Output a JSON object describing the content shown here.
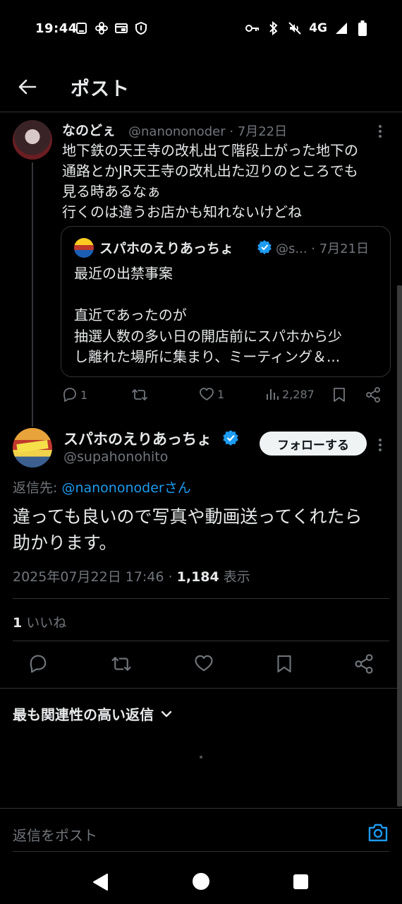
{
  "status_bar": {
    "time": "19:44",
    "network": "4G",
    "left_icons": [
      "screenshot-icon",
      "fan-icon",
      "cast-icon",
      "shield-icon"
    ],
    "right_icons": [
      "key-icon",
      "bluetooth-icon",
      "mute-icon",
      "signal-icon",
      "battery-icon"
    ]
  },
  "header": {
    "back_icon": "arrow-left-icon",
    "title": "ポスト"
  },
  "parent_tweet": {
    "name": "なのどぇ",
    "handle_date": "@nanononoder · 7月22日",
    "text": "地下鉄の天王寺の改札出て階段上がった地下の\n通路とかJR天王寺の改札出た辺りのところでも\n見る時あるなぁ\n行くのは違うお店かも知れないけどね",
    "quote": {
      "name": "スパホのえりあっちょ",
      "handle_date": "@s... · 7月21日",
      "text": "最近の出禁事案\n\n直近であったのが\n抽選人数の多い日の開店前にスパホから少\nし離れた場所に集まり、ミーティング＆..."
    },
    "actions": {
      "replies": "1",
      "retweets": "",
      "likes": "1",
      "views": "2,287"
    }
  },
  "main_tweet": {
    "name": "スパホのえりあっちょ",
    "handle": "@supahonohito",
    "follow_label": "フォローする",
    "reply_prefix": "返信先: ",
    "reply_mention": "@nanononoderさん",
    "text": "違っても良いので写真や動画送ってくれたら\n助かります。",
    "datetime": "2025年07月22日 17:46 · ",
    "views_count": "1,184",
    "views_label": " 表示",
    "likes_count": "1",
    "likes_label": " いいね"
  },
  "replies_section": {
    "sort_label": "最も関連性の高い返信"
  },
  "reply_bar": {
    "placeholder": "返信をポスト"
  },
  "colors": {
    "background": "#000000",
    "text": "#e7e9ea",
    "secondary": "#71767b",
    "accent": "#1d9bf0",
    "divider": "#2f3336"
  }
}
